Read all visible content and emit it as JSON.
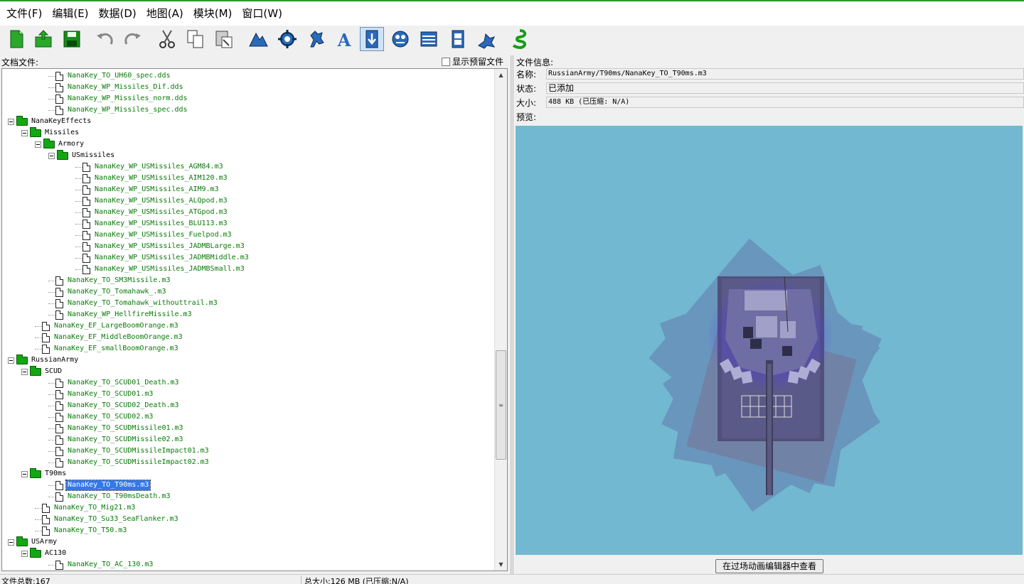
{
  "menu": [
    "文件(F)",
    "编辑(E)",
    "数据(D)",
    "地图(A)",
    "模块(M)",
    "窗口(W)"
  ],
  "toolbar": [
    {
      "icon": "new-document-icon"
    },
    {
      "icon": "open-folder-icon"
    },
    {
      "icon": "save-icon"
    },
    {
      "icon": "undo-icon"
    },
    {
      "icon": "redo-icon"
    },
    {
      "icon": "cut-icon"
    },
    {
      "icon": "copy-icon"
    },
    {
      "icon": "paste-icon"
    },
    {
      "icon": "terrain-editor-icon"
    },
    {
      "icon": "trigger-editor-icon"
    },
    {
      "icon": "unit-editor-icon"
    },
    {
      "icon": "text-editor-icon"
    },
    {
      "icon": "import-manager-icon"
    },
    {
      "icon": "ai-editor-icon"
    },
    {
      "icon": "data-editor-icon"
    },
    {
      "icon": "cutscene-editor-icon"
    },
    {
      "icon": "game-interface-icon"
    },
    {
      "icon": "starcraft-icon"
    }
  ],
  "left_panel": {
    "title": "文档文件:",
    "show_preview_label": "显示预留文件"
  },
  "tree": [
    {
      "d": 3,
      "t": "file",
      "n": "NanaKey_TO_UH60_spec.dds"
    },
    {
      "d": 3,
      "t": "file",
      "n": "NanaKey_WP_Missiles_Dif.dds"
    },
    {
      "d": 3,
      "t": "file",
      "n": "NanaKey_WP_Missiles_norm.dds"
    },
    {
      "d": 3,
      "t": "file",
      "n": "NanaKey_WP_Missiles_spec.dds"
    },
    {
      "d": 0,
      "t": "folder",
      "n": "NanaKeyEffects"
    },
    {
      "d": 1,
      "t": "folder",
      "n": "Missiles"
    },
    {
      "d": 2,
      "t": "folder",
      "n": "Armory"
    },
    {
      "d": 3,
      "t": "folder",
      "n": "USmissiles"
    },
    {
      "d": 5,
      "t": "file",
      "n": "NanaKey_WP_USMissiles_AGM84.m3"
    },
    {
      "d": 5,
      "t": "file",
      "n": "NanaKey_WP_USMissiles_AIM120.m3"
    },
    {
      "d": 5,
      "t": "file",
      "n": "NanaKey_WP_USMissiles_AIM9.m3"
    },
    {
      "d": 5,
      "t": "file",
      "n": "NanaKey_WP_USMissiles_ALQpod.m3"
    },
    {
      "d": 5,
      "t": "file",
      "n": "NanaKey_WP_USMissiles_ATGpod.m3"
    },
    {
      "d": 5,
      "t": "file",
      "n": "NanaKey_WP_USMissiles_BLU113.m3"
    },
    {
      "d": 5,
      "t": "file",
      "n": "NanaKey_WP_USMissiles_Fuelpod.m3"
    },
    {
      "d": 5,
      "t": "file",
      "n": "NanaKey_WP_USMissiles_JADMBLarge.m3"
    },
    {
      "d": 5,
      "t": "file",
      "n": "NanaKey_WP_USMissiles_JADMBMiddle.m3"
    },
    {
      "d": 5,
      "t": "file",
      "n": "NanaKey_WP_USMissiles_JADMBSmall.m3"
    },
    {
      "d": 3,
      "t": "file",
      "n": "NanaKey_TO_SM3Missile.m3"
    },
    {
      "d": 3,
      "t": "file",
      "n": "NanaKey_TO_Tomahawk_.m3"
    },
    {
      "d": 3,
      "t": "file",
      "n": "NanaKey_TO_Tomahawk_withouttrail.m3"
    },
    {
      "d": 3,
      "t": "file",
      "n": "NanaKey_WP_HellfireMissile.m3"
    },
    {
      "d": 2,
      "t": "file",
      "n": "NanaKey_EF_LargeBoomOrange.m3"
    },
    {
      "d": 2,
      "t": "file",
      "n": "NanaKey_EF_MiddleBoomOrange.m3"
    },
    {
      "d": 2,
      "t": "file",
      "n": "NanaKey_EF_smallBoomOrange.m3"
    },
    {
      "d": 0,
      "t": "folder",
      "n": "RussianArmy"
    },
    {
      "d": 1,
      "t": "folder",
      "n": "SCUD"
    },
    {
      "d": 3,
      "t": "file",
      "n": "NanaKey_TO_SCUD01_Death.m3"
    },
    {
      "d": 3,
      "t": "file",
      "n": "NanaKey_TO_SCUD01.m3"
    },
    {
      "d": 3,
      "t": "file",
      "n": "NanaKey_TO_SCUD02_Death.m3"
    },
    {
      "d": 3,
      "t": "file",
      "n": "NanaKey_TO_SCUD02.m3"
    },
    {
      "d": 3,
      "t": "file",
      "n": "NanaKey_TO_SCUDMissile01.m3"
    },
    {
      "d": 3,
      "t": "file",
      "n": "NanaKey_TO_SCUDMissile02.m3"
    },
    {
      "d": 3,
      "t": "file",
      "n": "NanaKey_TO_SCUDMissileImpact01.m3"
    },
    {
      "d": 3,
      "t": "file",
      "n": "NanaKey_TO_SCUDMissileImpact02.m3"
    },
    {
      "d": 1,
      "t": "folder",
      "n": "T90ms"
    },
    {
      "d": 3,
      "t": "file",
      "n": "NanaKey_TO_T90ms.m3",
      "selected": true
    },
    {
      "d": 3,
      "t": "file",
      "n": "NanaKey_TO_T90msDeath.m3"
    },
    {
      "d": 2,
      "t": "file",
      "n": "NanaKey_TO_Mig21.m3"
    },
    {
      "d": 2,
      "t": "file",
      "n": "NanaKey_TO_Su33_SeaFlanker.m3"
    },
    {
      "d": 2,
      "t": "file",
      "n": "NanaKey_TO_T50.m3"
    },
    {
      "d": 0,
      "t": "folder",
      "n": "USArmy"
    },
    {
      "d": 1,
      "t": "folder",
      "n": "AC130"
    },
    {
      "d": 3,
      "t": "file",
      "n": "NanaKey_TO_AC_130.m3"
    }
  ],
  "file_info": {
    "title": "文件信息:",
    "name_label": "名称:",
    "name_value": "RussianArmy/T90ms/NanaKey_TO_T90ms.m3",
    "status_label": "状态:",
    "status_value": "已添加",
    "size_label": "大小:",
    "size_value": "488 KB (已压缩: N/A)",
    "preview_label": "预览:"
  },
  "preview_bg_color": "#72b8d0",
  "open_in_cutscene_button": "在过场动画编辑器中查看",
  "status": {
    "file_count": "文件总数:167",
    "total_size": "总大小:126 MB (已压缩:N/A)"
  }
}
